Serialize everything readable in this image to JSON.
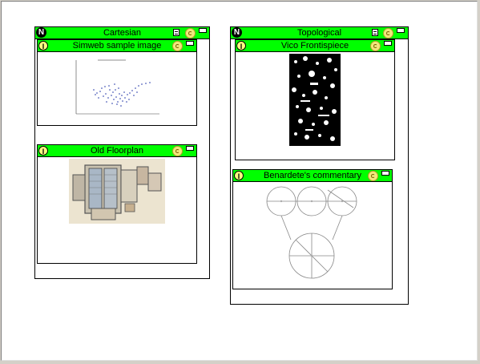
{
  "workspaces": [
    {
      "title": "Cartesian",
      "badge": "N",
      "items": [
        {
          "title": "Simweb sample image",
          "badge": "I"
        },
        {
          "title": "Old Floorplan",
          "badge": "I"
        }
      ]
    },
    {
      "title": "Topological",
      "badge": "N",
      "items": [
        {
          "title": "Vico Frontispiece",
          "badge": "I"
        },
        {
          "title": "Benardete's commentary",
          "badge": "I"
        }
      ]
    }
  ],
  "icons": {
    "menu": "list-icon",
    "coin": "coin-icon",
    "minimize": "minimize-icon"
  }
}
